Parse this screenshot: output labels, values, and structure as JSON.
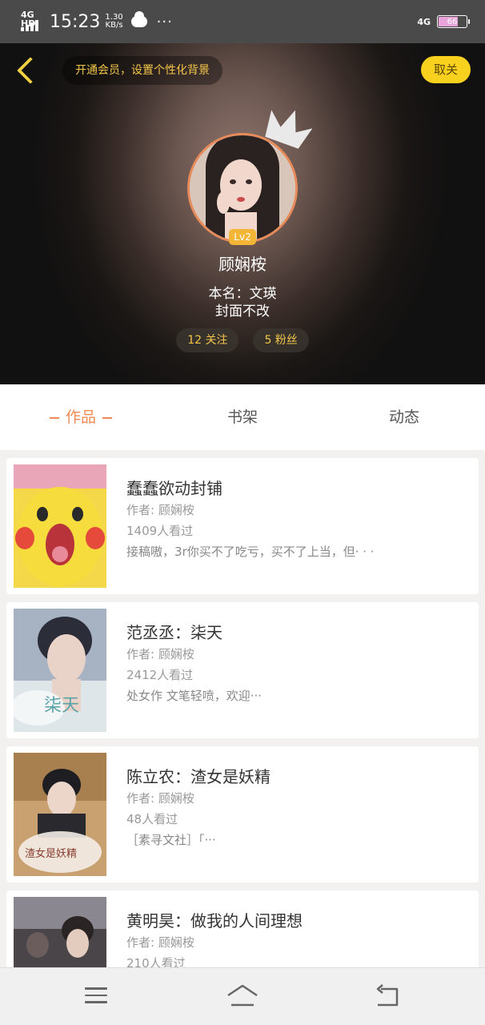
{
  "status_bar": {
    "network_label": "4G HD",
    "time": "15:23",
    "speed_value": "1.30",
    "speed_unit": "KB/s",
    "dots": "···",
    "network_right": "4G",
    "battery": "66"
  },
  "header": {
    "vip_prompt": "开通会员，设置个性化背景",
    "close_label": "取关",
    "level": "Lv2",
    "username": "顾娴桉",
    "bio_line1": "本名：文瑛",
    "bio_line2": "封面不改",
    "following": "12 关注",
    "followers": "5 粉丝"
  },
  "tabs": [
    {
      "label": "作品",
      "active": true
    },
    {
      "label": "书架",
      "active": false
    },
    {
      "label": "动态",
      "active": false
    }
  ],
  "works": [
    {
      "title": "蠢蠢欲动封铺",
      "author": "作者: 顾娴桉",
      "views": "1409人看过",
      "desc": "接稿嗷，3r你买不了吃亏，买不了上当，但· · ·",
      "cover_style": "pikachu"
    },
    {
      "title": "范丞丞：柒天",
      "author": "作者: 顾娴桉",
      "views": "2412人看过",
      "desc": "处女作 文笔轻喷，欢迎···",
      "cover_style": "portrait-blue",
      "cover_text": "柒天"
    },
    {
      "title": "陈立农：渣女是妖精",
      "author": "作者: 顾娴桉",
      "views": "48人看过",
      "desc": "［素寻文社］「···",
      "cover_style": "portrait-autumn",
      "cover_text": "渣女是妖精"
    },
    {
      "title": "黄明昊：做我的人间理想",
      "author": "作者: 顾娴桉",
      "views": "210人看过",
      "desc": "",
      "cover_style": "portrait-dark"
    }
  ],
  "colors": {
    "accent": "#ef8a55",
    "gold": "#f3c64a",
    "close_button": "#f8d11f"
  }
}
